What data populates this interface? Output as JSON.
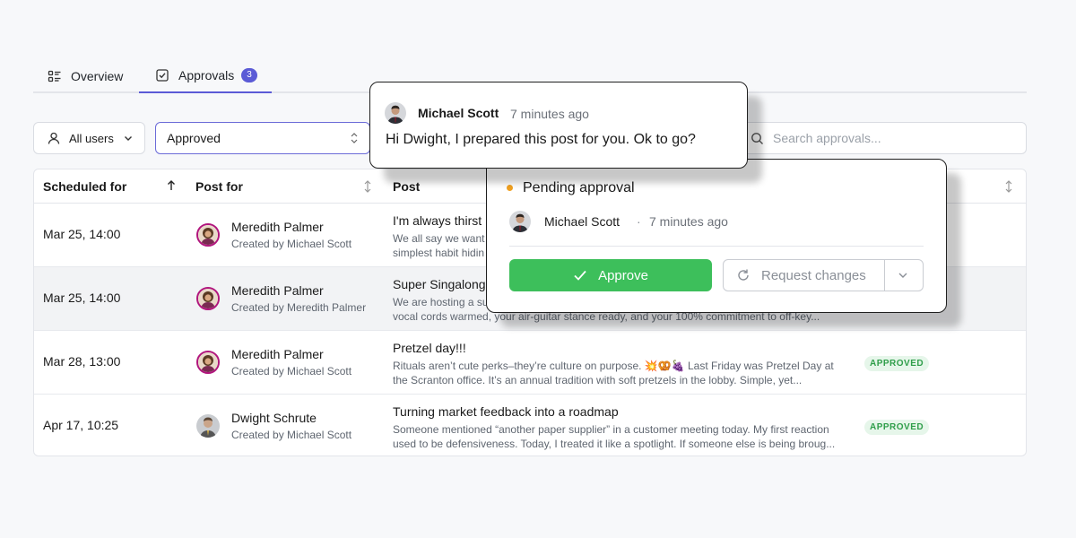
{
  "tabs": [
    {
      "label": "Overview",
      "icon": "list-icon",
      "active": false
    },
    {
      "label": "Approvals",
      "icon": "checkbox-icon",
      "active": true,
      "count": "3"
    }
  ],
  "filters": {
    "users_label": "All users",
    "status_value": "Approved",
    "search_placeholder": "Search approvals..."
  },
  "table": {
    "headers": {
      "scheduled": "Scheduled for",
      "post_for": "Post for",
      "post": "Post"
    },
    "rows": [
      {
        "date": "Mar 25, 14:00",
        "name": "Meredith Palmer",
        "creator": "Created by Michael Scott",
        "title": "I'm always thirst",
        "excerpt1": "We all say we want",
        "excerpt2": "simplest habit hidin",
        "status": ""
      },
      {
        "date": "Mar 25, 14:00",
        "name": "Meredith Palmer",
        "creator": "Created by Meredith Palmer",
        "title": "Super Singalong",
        "excerpt1": "We are hosting a su",
        "excerpt2": "vocal cords warmed, your air-guitar stance ready, and your 100% commitment to off-key...",
        "status": ""
      },
      {
        "date": "Mar 28, 13:00",
        "name": "Meredith Palmer",
        "creator": "Created by Michael Scott",
        "title": "Pretzel day!!!",
        "excerpt1": "Rituals aren’t cute perks–they’re culture on purpose. 💥🥨🍇 Last Friday was Pretzel Day at",
        "excerpt2": "the Scranton office. It’s an annual tradition with soft pretzels in the lobby. Simple, yet...",
        "status": "APPROVED"
      },
      {
        "date": "Apr 17, 10:25",
        "name": "Dwight Schrute",
        "creator": "Created by Michael Scott",
        "title": "Turning market feedback into a roadmap",
        "excerpt1": "Someone mentioned “another paper supplier” in a customer meeting today. My first reaction",
        "excerpt2": "used to be defensiveness. Today, I treated it like a spotlight. If someone else is being broug...",
        "status": "APPROVED"
      }
    ]
  },
  "comment": {
    "author": "Michael Scott",
    "time": "7 minutes ago",
    "text": "Hi Dwight, I prepared this post for you. Ok to go?"
  },
  "approval": {
    "status_title": "Pending approval",
    "author": "Michael Scott",
    "separator": "·",
    "time": "7 minutes ago",
    "approve_label": "Approve",
    "request_label": "Request changes"
  },
  "colors": {
    "accent": "#5b5bd6",
    "approve_green": "#3dbf5b",
    "pending_orange": "#f0a020",
    "approved_badge_text": "#2f9e4a",
    "meredith_ring": "#b1157d"
  }
}
